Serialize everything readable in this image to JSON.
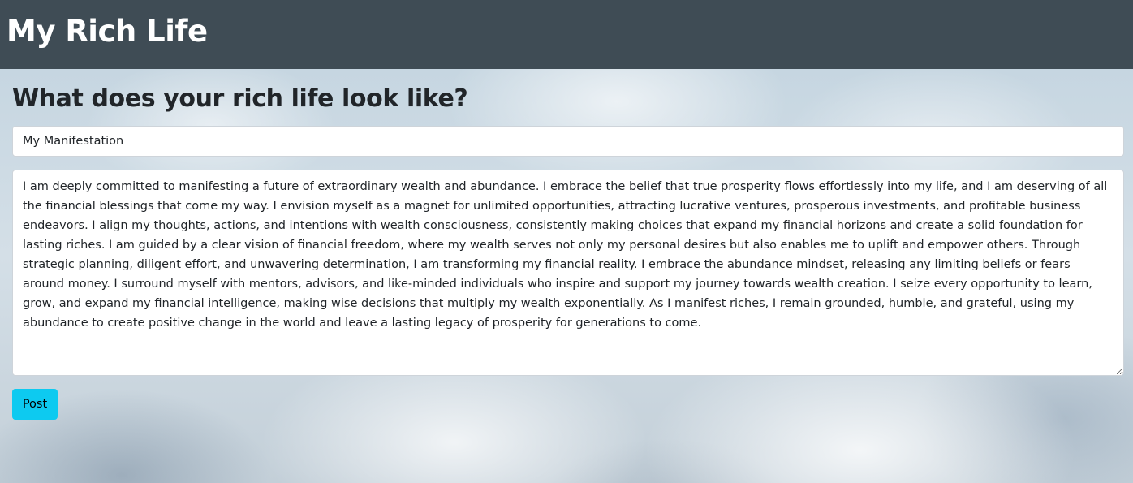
{
  "header": {
    "brand": "My Rich Life"
  },
  "main": {
    "heading": "What does your rich life look like?",
    "title_input": {
      "value": "My Manifestation",
      "placeholder": ""
    },
    "body_textarea": {
      "value": "I am deeply committed to manifesting a future of extraordinary wealth and abundance. I embrace the belief that true prosperity flows effortlessly into my life, and I am deserving of all the financial blessings that come my way. I envision myself as a magnet for unlimited opportunities, attracting lucrative ventures, prosperous investments, and profitable business endeavors. I align my thoughts, actions, and intentions with wealth consciousness, consistently making choices that expand my financial horizons and create a solid foundation for lasting riches. I am guided by a clear vision of financial freedom, where my wealth serves not only my personal desires but also enables me to uplift and empower others. Through strategic planning, diligent effort, and unwavering determination, I am transforming my financial reality. I embrace the abundance mindset, releasing any limiting beliefs or fears around money. I surround myself with mentors, advisors, and like-minded individuals who inspire and support my journey towards wealth creation. I seize every opportunity to learn, grow, and expand my financial intelligence, making wise decisions that multiply my wealth exponentially. As I manifest riches, I remain grounded, humble, and grateful, using my abundance to create positive change in the world and leave a lasting legacy of prosperity for generations to come."
    },
    "post_button_label": "Post"
  },
  "colors": {
    "navbar_bg": "#3f4c55",
    "button_bg": "#0dcaf0",
    "heading_text": "#212529"
  }
}
